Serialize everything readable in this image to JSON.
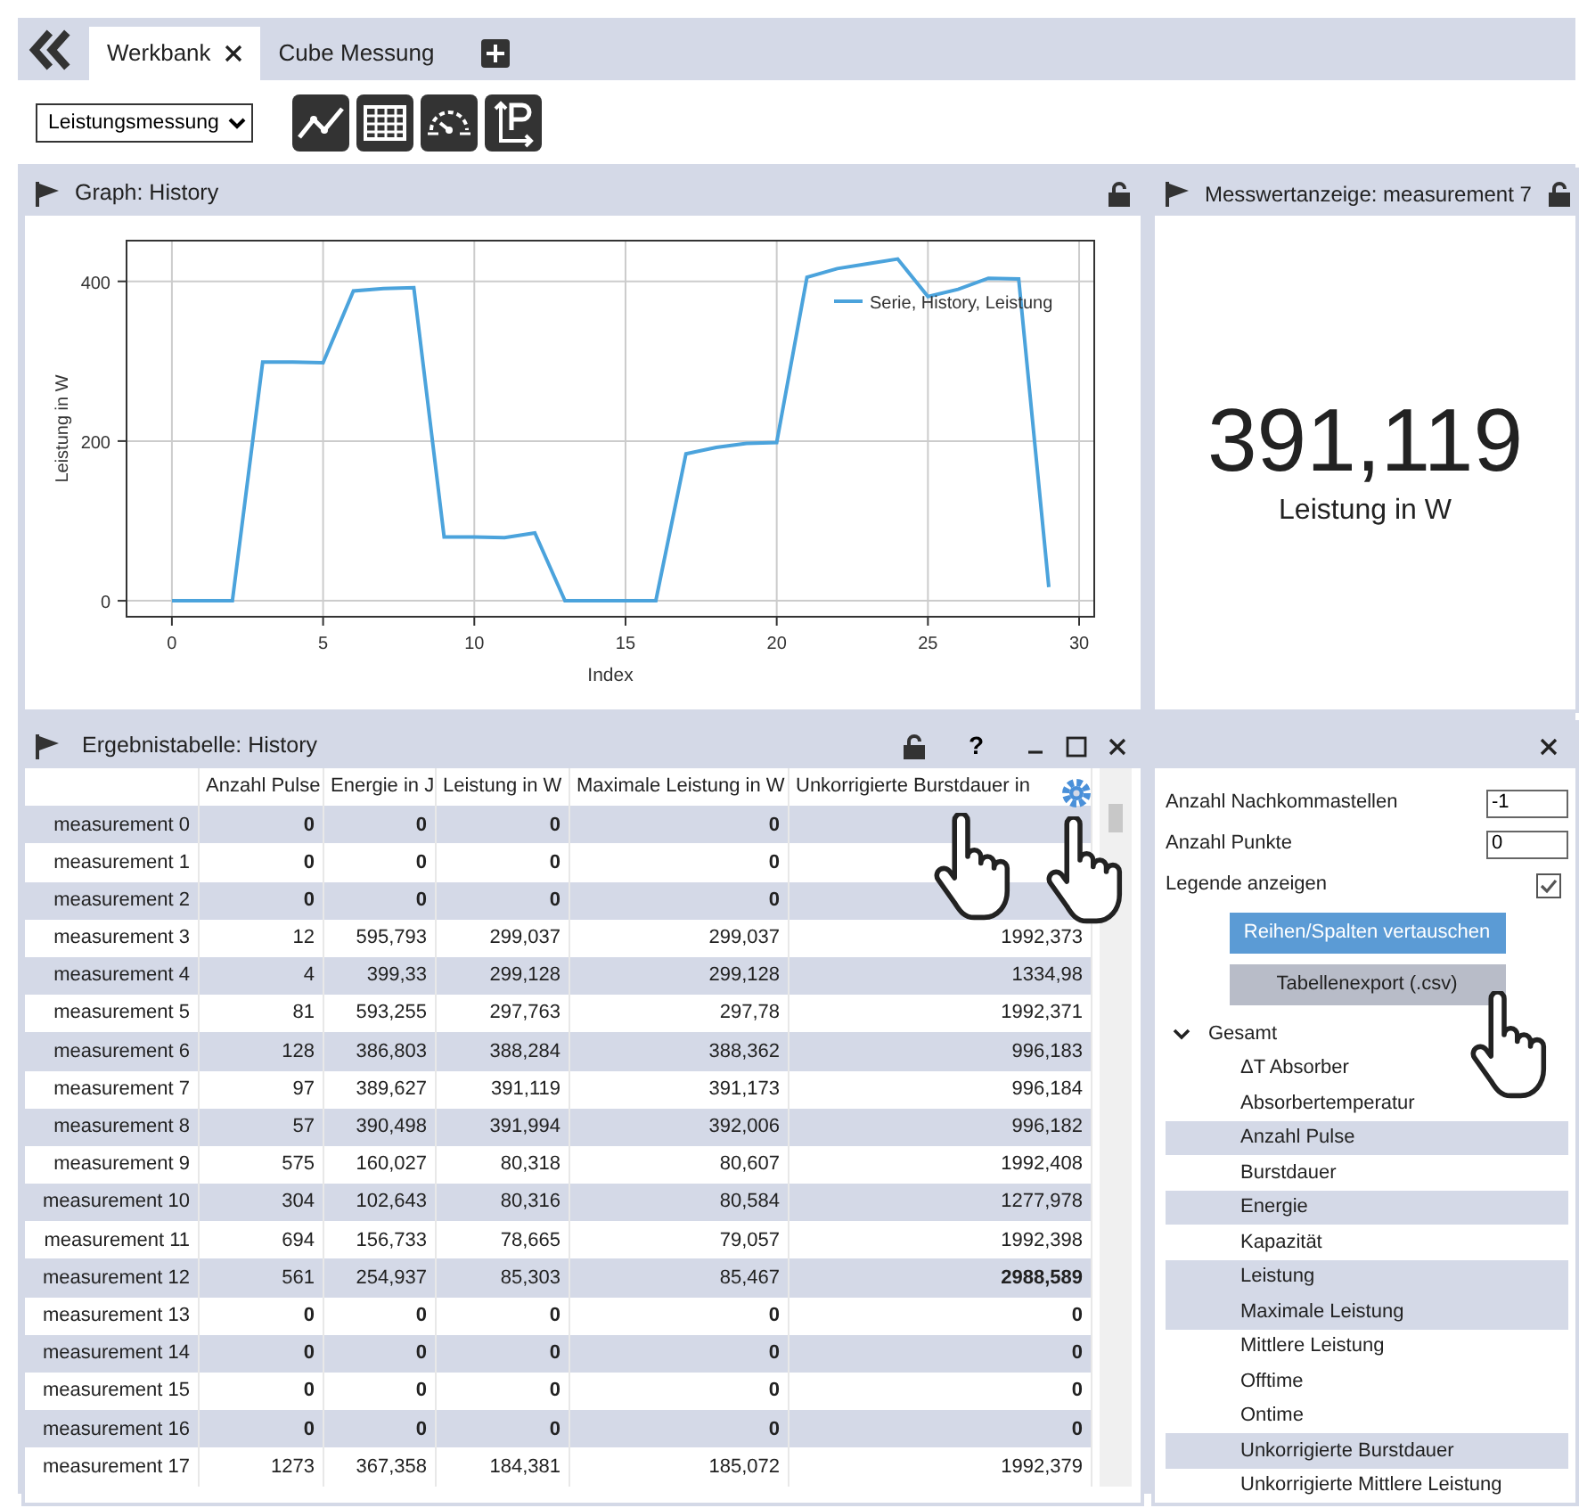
{
  "tabs": [
    {
      "label": "Werkbank",
      "selected": true,
      "closable": true
    },
    {
      "label": "Cube Messung",
      "selected": false,
      "closable": false
    }
  ],
  "toolbar": {
    "dropdown": "Leistungsmessung"
  },
  "graph_panel": {
    "title": "Graph: History",
    "chart_data": {
      "type": "line",
      "xlabel": "Index",
      "ylabel": "Leistung  in W",
      "x": [
        0,
        1,
        2,
        3,
        4,
        5,
        6,
        7,
        8,
        9,
        10,
        11,
        12,
        13,
        14,
        15,
        16,
        17,
        18,
        19,
        20,
        21,
        22,
        23,
        24,
        25,
        26,
        27,
        28,
        29
      ],
      "series": [
        {
          "name": "Serie, History, Leistung",
          "color": "#4ba3dc",
          "values": [
            0,
            0,
            0,
            299,
            299,
            298,
            388,
            391,
            392,
            80,
            80,
            79,
            85,
            0,
            0,
            0,
            0,
            184,
            192,
            197,
            198,
            405,
            416,
            422,
            428,
            381,
            390,
            404,
            403,
            17
          ]
        }
      ],
      "xlim": [
        -1.5,
        30.5
      ],
      "ylim": [
        -20,
        451
      ],
      "xticks": [
        0,
        5,
        10,
        15,
        20,
        25,
        30
      ],
      "yticks": [
        0,
        200,
        400
      ],
      "grid": true
    }
  },
  "value_panel": {
    "title": "Messwertanzeige: measurement 7",
    "value": "391,119",
    "label": "Leistung in W"
  },
  "table_panel": {
    "title": "Ergebnistabelle: History",
    "controls": [
      "?"
    ],
    "columns": [
      "Anzahl Pulse",
      "Energie in J",
      "Leistung in W",
      "Maximale Leistung in W",
      "Unkorrigierte Burstdauer in"
    ],
    "rows": [
      {
        "label": "measurement 0",
        "cells": [
          {
            "text": "0",
            "bold": true
          },
          {
            "text": "0",
            "bold": true
          },
          {
            "text": "0",
            "bold": true
          },
          {
            "text": "0",
            "bold": true
          }
        ]
      },
      {
        "label": "measurement 1",
        "cells": [
          {
            "text": "0",
            "bold": true
          },
          {
            "text": "0",
            "bold": true
          },
          {
            "text": "0",
            "bold": true
          },
          {
            "text": "0",
            "bold": true
          }
        ]
      },
      {
        "label": "measurement 2",
        "cells": [
          {
            "text": "0",
            "bold": true
          },
          {
            "text": "0",
            "bold": true
          },
          {
            "text": "0",
            "bold": true
          },
          {
            "text": "0",
            "bold": true
          }
        ]
      },
      {
        "label": "measurement 3",
        "cells": [
          {
            "text": "12",
            "bold": false
          },
          {
            "text": "595,793",
            "bold": false
          },
          {
            "text": "299,037",
            "bold": false
          },
          {
            "text": "299,037",
            "bold": false
          },
          {
            "text": "1992,373",
            "bold": false
          }
        ]
      },
      {
        "label": "measurement 4",
        "cells": [
          {
            "text": "4",
            "bold": false
          },
          {
            "text": "399,33",
            "bold": false
          },
          {
            "text": "299,128",
            "bold": false
          },
          {
            "text": "299,128",
            "bold": false
          },
          {
            "text": "1334,98",
            "bold": false
          }
        ]
      },
      {
        "label": "measurement 5",
        "cells": [
          {
            "text": "81",
            "bold": false
          },
          {
            "text": "593,255",
            "bold": false
          },
          {
            "text": "297,763",
            "bold": false
          },
          {
            "text": "297,78",
            "bold": false
          },
          {
            "text": "1992,371",
            "bold": false
          }
        ]
      },
      {
        "label": "measurement 6",
        "cells": [
          {
            "text": "128",
            "bold": false
          },
          {
            "text": "386,803",
            "bold": false
          },
          {
            "text": "388,284",
            "bold": false
          },
          {
            "text": "388,362",
            "bold": false
          },
          {
            "text": "996,183",
            "bold": false
          }
        ]
      },
      {
        "label": "measurement 7",
        "cells": [
          {
            "text": "97",
            "bold": false
          },
          {
            "text": "389,627",
            "bold": false
          },
          {
            "text": "391,119",
            "bold": false
          },
          {
            "text": "391,173",
            "bold": false
          },
          {
            "text": "996,184",
            "bold": false
          }
        ]
      },
      {
        "label": "measurement 8",
        "cells": [
          {
            "text": "57",
            "bold": false
          },
          {
            "text": "390,498",
            "bold": false
          },
          {
            "text": "391,994",
            "bold": false
          },
          {
            "text": "392,006",
            "bold": false
          },
          {
            "text": "996,182",
            "bold": false
          }
        ]
      },
      {
        "label": "measurement 9",
        "cells": [
          {
            "text": "575",
            "bold": false
          },
          {
            "text": "160,027",
            "bold": false
          },
          {
            "text": "80,318",
            "bold": false
          },
          {
            "text": "80,607",
            "bold": false
          },
          {
            "text": "1992,408",
            "bold": false
          }
        ]
      },
      {
        "label": "measurement 10",
        "cells": [
          {
            "text": "304",
            "bold": false
          },
          {
            "text": "102,643",
            "bold": false
          },
          {
            "text": "80,316",
            "bold": false
          },
          {
            "text": "80,584",
            "bold": false
          },
          {
            "text": "1277,978",
            "bold": false
          }
        ]
      },
      {
        "label": "measurement 11",
        "cells": [
          {
            "text": "694",
            "bold": false
          },
          {
            "text": "156,733",
            "bold": false
          },
          {
            "text": "78,665",
            "bold": false
          },
          {
            "text": "79,057",
            "bold": false
          },
          {
            "text": "1992,398",
            "bold": false
          }
        ]
      },
      {
        "label": "measurement 12",
        "cells": [
          {
            "text": "561",
            "bold": false
          },
          {
            "text": "254,937",
            "bold": false
          },
          {
            "text": "85,303",
            "bold": false
          },
          {
            "text": "85,467",
            "bold": false
          },
          {
            "text": "2988,589",
            "bold": true
          }
        ]
      },
      {
        "label": "measurement 13",
        "cells": [
          {
            "text": "0",
            "bold": true
          },
          {
            "text": "0",
            "bold": true
          },
          {
            "text": "0",
            "bold": true
          },
          {
            "text": "0",
            "bold": true
          },
          {
            "text": "0",
            "bold": true
          }
        ]
      },
      {
        "label": "measurement 14",
        "cells": [
          {
            "text": "0",
            "bold": true
          },
          {
            "text": "0",
            "bold": true
          },
          {
            "text": "0",
            "bold": true
          },
          {
            "text": "0",
            "bold": true
          },
          {
            "text": "0",
            "bold": true
          }
        ]
      },
      {
        "label": "measurement 15",
        "cells": [
          {
            "text": "0",
            "bold": true
          },
          {
            "text": "0",
            "bold": true
          },
          {
            "text": "0",
            "bold": true
          },
          {
            "text": "0",
            "bold": true
          },
          {
            "text": "0",
            "bold": true
          }
        ]
      },
      {
        "label": "measurement 16",
        "cells": [
          {
            "text": "0",
            "bold": true
          },
          {
            "text": "0",
            "bold": true
          },
          {
            "text": "0",
            "bold": true
          },
          {
            "text": "0",
            "bold": true
          },
          {
            "text": "0",
            "bold": true
          }
        ]
      },
      {
        "label": "measurement 17",
        "cells": [
          {
            "text": "1273",
            "bold": false
          },
          {
            "text": "367,358",
            "bold": false
          },
          {
            "text": "184,381",
            "bold": false
          },
          {
            "text": "185,072",
            "bold": false
          },
          {
            "text": "1992,379",
            "bold": false
          }
        ]
      }
    ]
  },
  "settings_panel": {
    "fields": [
      {
        "label": "Anzahl Nachkommastellen",
        "value": "-1"
      },
      {
        "label": "Anzahl Punkte",
        "value": "0"
      }
    ],
    "legend": {
      "label": "Legende anzeigen",
      "checked": true
    },
    "buttons": [
      {
        "label": "Reihen/Spalten vertauschen",
        "kind": "primary"
      },
      {
        "label": "Tabellenexport (.csv)",
        "kind": "secondary"
      }
    ],
    "tree": [
      {
        "label": "Gesamt",
        "expanded": true,
        "selected": false,
        "children": [
          {
            "label": "ΔT Absorber",
            "selected": false
          },
          {
            "label": "Absorbertemperatur",
            "selected": false
          },
          {
            "label": "Anzahl Pulse",
            "selected": true
          },
          {
            "label": "Burstdauer",
            "selected": false
          },
          {
            "label": "Energie",
            "selected": true
          },
          {
            "label": "Kapazität",
            "selected": false
          },
          {
            "label": "Leistung",
            "selected": true
          },
          {
            "label": "Maximale Leistung",
            "selected": true
          },
          {
            "label": "Mittlere Leistung",
            "selected": false
          },
          {
            "label": "Offtime",
            "selected": false
          },
          {
            "label": "Ontime",
            "selected": false
          },
          {
            "label": "Unkorrigierte Burstdauer",
            "selected": true
          },
          {
            "label": "Unkorrigierte Mittlere Leistung",
            "selected": false
          }
        ]
      }
    ]
  }
}
